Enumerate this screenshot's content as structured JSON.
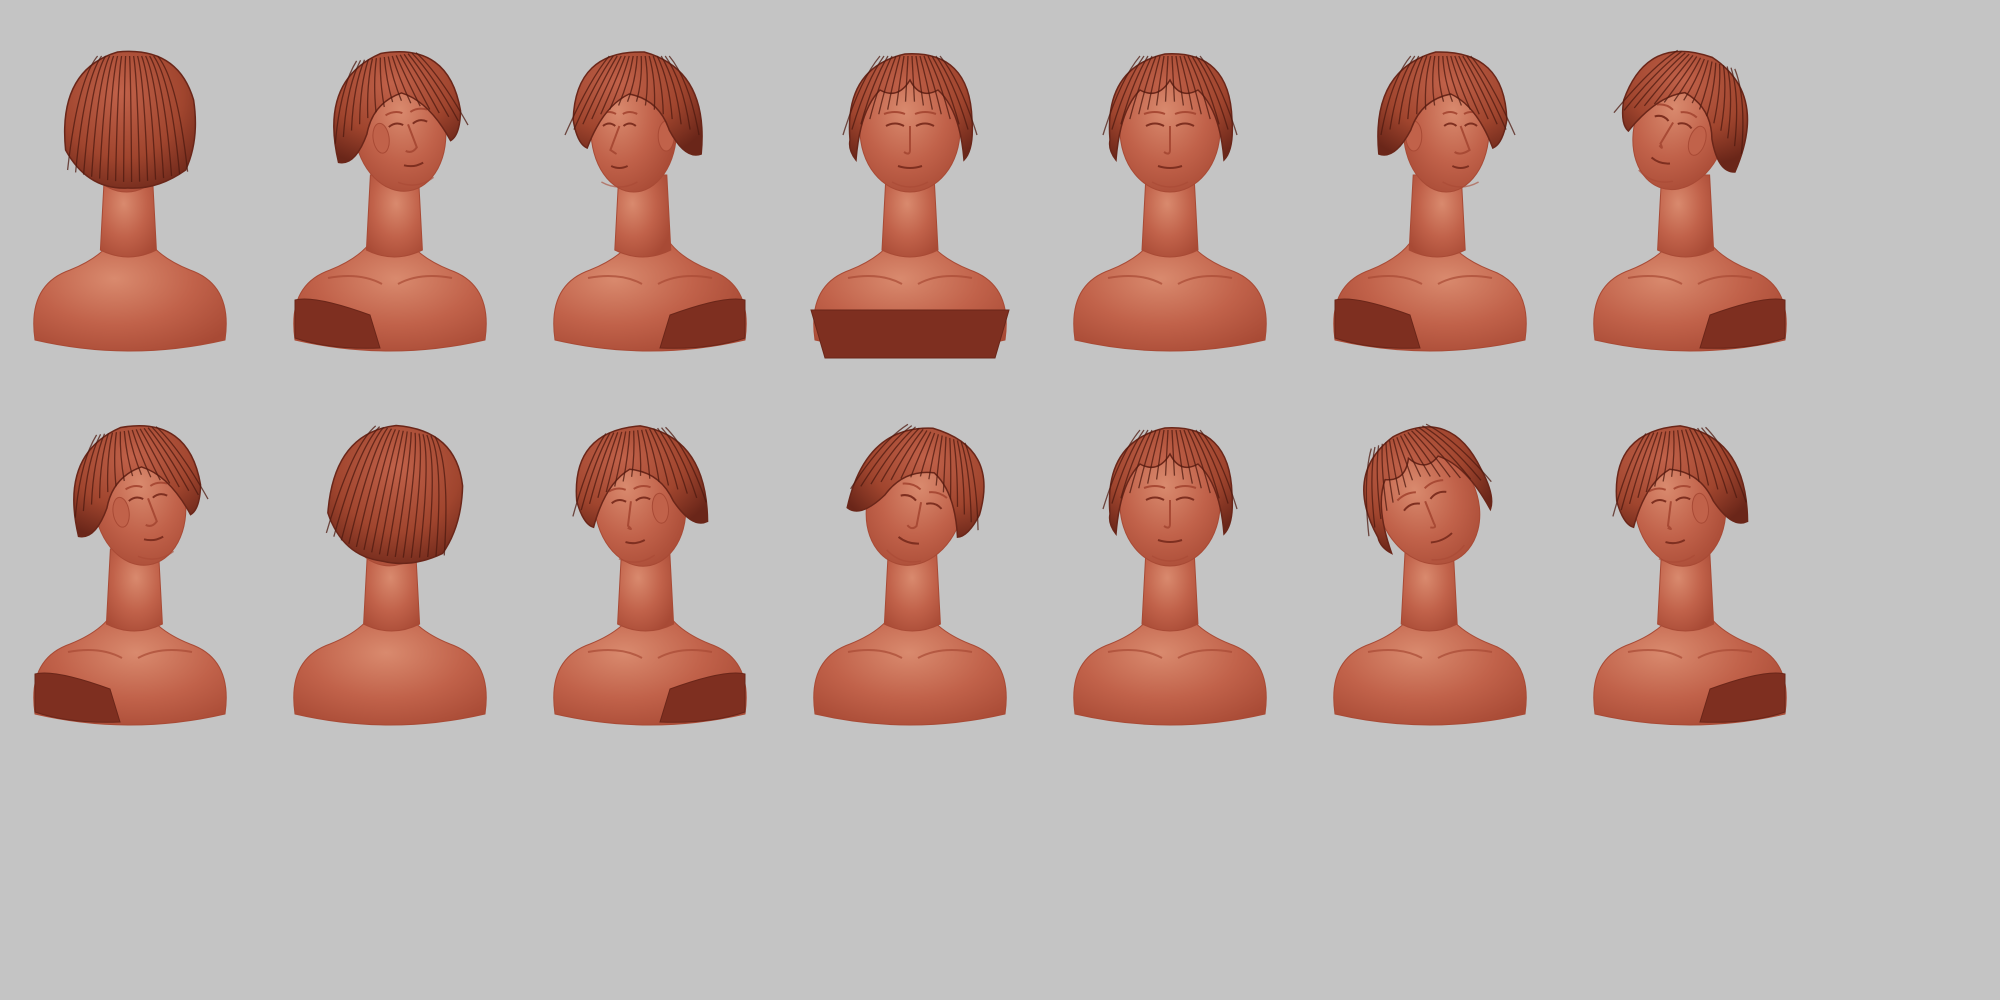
{
  "colors": {
    "background": "#c4c4c4",
    "clay_light": "#d98a6e",
    "clay_base": "#c1624a",
    "clay_mid": "#a84a35",
    "clay_dark": "#7e2f20",
    "hair_base": "#a0452e",
    "hair_dark": "#6a2619",
    "hair_strand": "#4e1a10"
  },
  "rows": [
    {
      "views": [
        {
          "view": "back-left"
        },
        {
          "view": "three-quarter-right"
        },
        {
          "view": "profile-left"
        },
        {
          "view": "front-low"
        },
        {
          "view": "front"
        },
        {
          "view": "profile-right"
        },
        {
          "view": "three-quarter-up-left"
        }
      ]
    },
    {
      "views": [
        {
          "view": "three-quarter-right"
        },
        {
          "view": "back-high"
        },
        {
          "view": "three-quarter-left"
        },
        {
          "view": "top-down-right"
        },
        {
          "view": "front"
        },
        {
          "view": "top-down"
        },
        {
          "view": "three-quarter-left"
        }
      ]
    }
  ]
}
